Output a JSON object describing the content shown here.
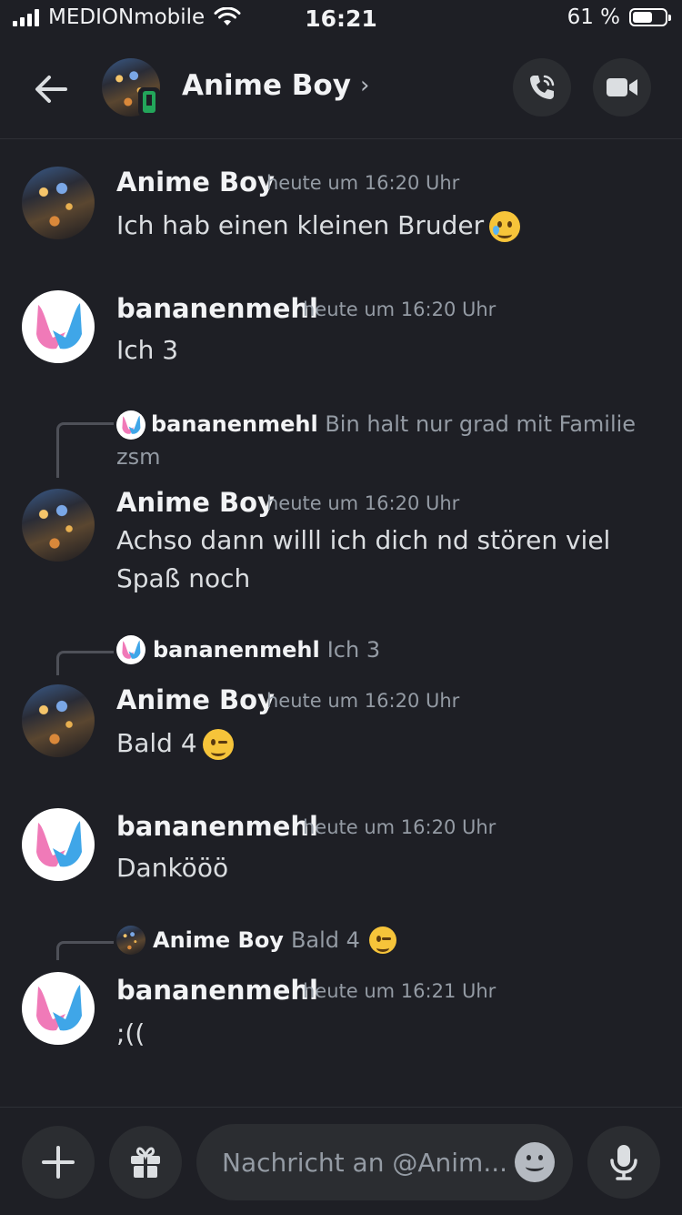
{
  "status_bar": {
    "carrier": "MEDIONmobile",
    "time": "16:21",
    "battery_percent": "61 %",
    "battery_level": 0.61
  },
  "header": {
    "title": "Anime Boy",
    "chevron": "›"
  },
  "messages": [
    {
      "author": "Anime Boy",
      "time": "heute um 16:20 Uhr",
      "text": "Ich hab einen kleinen Bruder"
    },
    {
      "author": "bananenmehl",
      "time": "heute um 16:20 Uhr",
      "text": "Ich 3"
    },
    {
      "reply_author": "bananenmehl",
      "reply_text": "Bin halt nur grad mit Familie zsm",
      "author": "Anime Boy",
      "time": "heute um 16:20 Uhr",
      "text": "Achso dann willl ich dich nd stören viel Spaß noch"
    },
    {
      "reply_author": "bananenmehl",
      "reply_text": "Ich 3",
      "author": "Anime Boy",
      "time": "heute um 16:20 Uhr",
      "text": "Bald 4"
    },
    {
      "author": "bananenmehl",
      "time": "heute um 16:20 Uhr",
      "text": "Dankööö"
    },
    {
      "reply_author": "Anime Boy",
      "reply_text": "Bald 4",
      "author": "bananenmehl",
      "time": "heute um 16:21 Uhr",
      "text": ";(("
    }
  ],
  "composer": {
    "placeholder": "Nachricht an @Anim..."
  },
  "icons": {
    "back": "arrow-left-icon",
    "call": "phone-icon",
    "video": "video-camera-icon",
    "add": "plus-icon",
    "gift": "gift-icon",
    "emoji": "smiley-icon",
    "mic": "microphone-icon"
  },
  "colors": {
    "background": "#1e1f25",
    "surface": "#2b2d31",
    "online_mobile": "#23a55a",
    "muted_text": "#949ba4"
  }
}
